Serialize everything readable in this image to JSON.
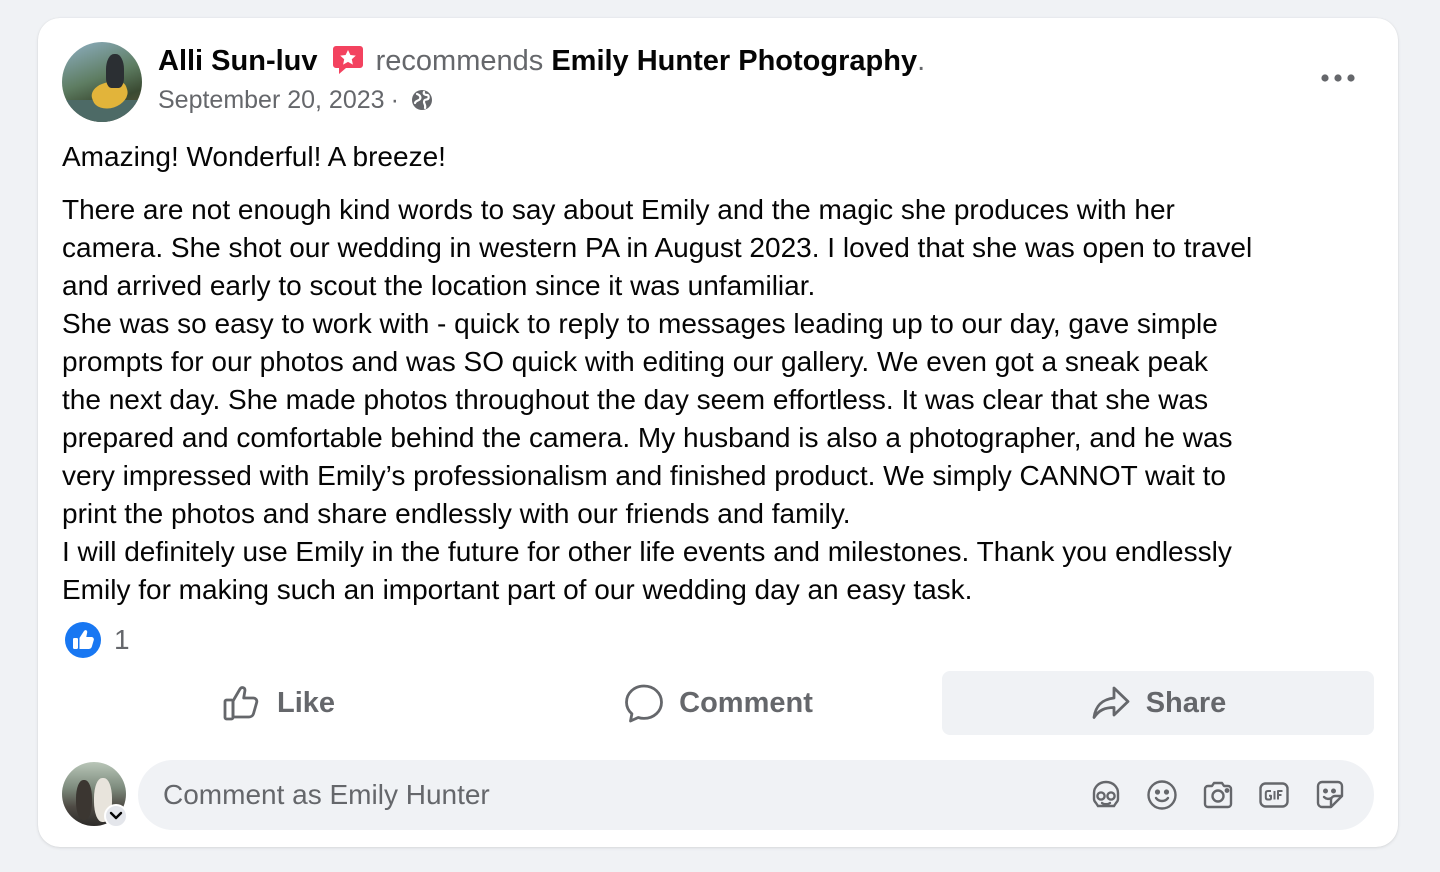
{
  "post": {
    "author": "Alli Sun-luv",
    "recommends_text": "recommends",
    "page_name": "Emily Hunter Photography",
    "period": ".",
    "date": "September 20, 2023",
    "separator": "·",
    "headline": "Amazing! Wonderful! A breeze!",
    "body_lines": [
      "There are not enough kind words to say about Emily and the magic she produces with her",
      "camera. She shot our wedding in western PA in August 2023. I loved that she was open to travel",
      "and arrived early to scout the location since it was unfamiliar.",
      "She was so easy to work with - quick to reply to messages leading up to our day, gave simple",
      "prompts for our photos and was SO quick with editing our gallery. We even got a sneak peak",
      "the next day. She made photos throughout the day seem effortless. It was clear that she was",
      "prepared and comfortable behind the camera. My husband is also a photographer, and he was",
      "very impressed with Emily’s professionalism and finished product. We simply CANNOT wait to",
      "print the photos and share endlessly with our friends and family.",
      "I will definitely use Emily in the future for other life events and milestones. Thank you endlessly",
      "Emily for making such an important part of our wedding day an easy task."
    ],
    "reaction_count": "1"
  },
  "actions": {
    "like_label": "Like",
    "comment_label": "Comment",
    "share_label": "Share"
  },
  "composer": {
    "placeholder": "Comment as Emily Hunter",
    "value": ""
  },
  "icons": {
    "recommendation_badge": "recommendation-star-icon",
    "audience": "globe-icon",
    "more": "more-horizontal-icon",
    "like_reaction": "thumbs-up-icon",
    "comment": "speech-bubble-icon",
    "share": "share-arrow-icon",
    "avatar_sticker": "avatar-icon",
    "emoji": "smiley-icon",
    "camera": "camera-icon",
    "gif": "gif-icon",
    "sticker": "sticker-icon"
  },
  "colors": {
    "background": "#f0f2f5",
    "card": "#ffffff",
    "text_primary": "#050505",
    "text_secondary": "#65676b",
    "like_blue": "#1877f2",
    "recommend_red": "#f3425f"
  }
}
